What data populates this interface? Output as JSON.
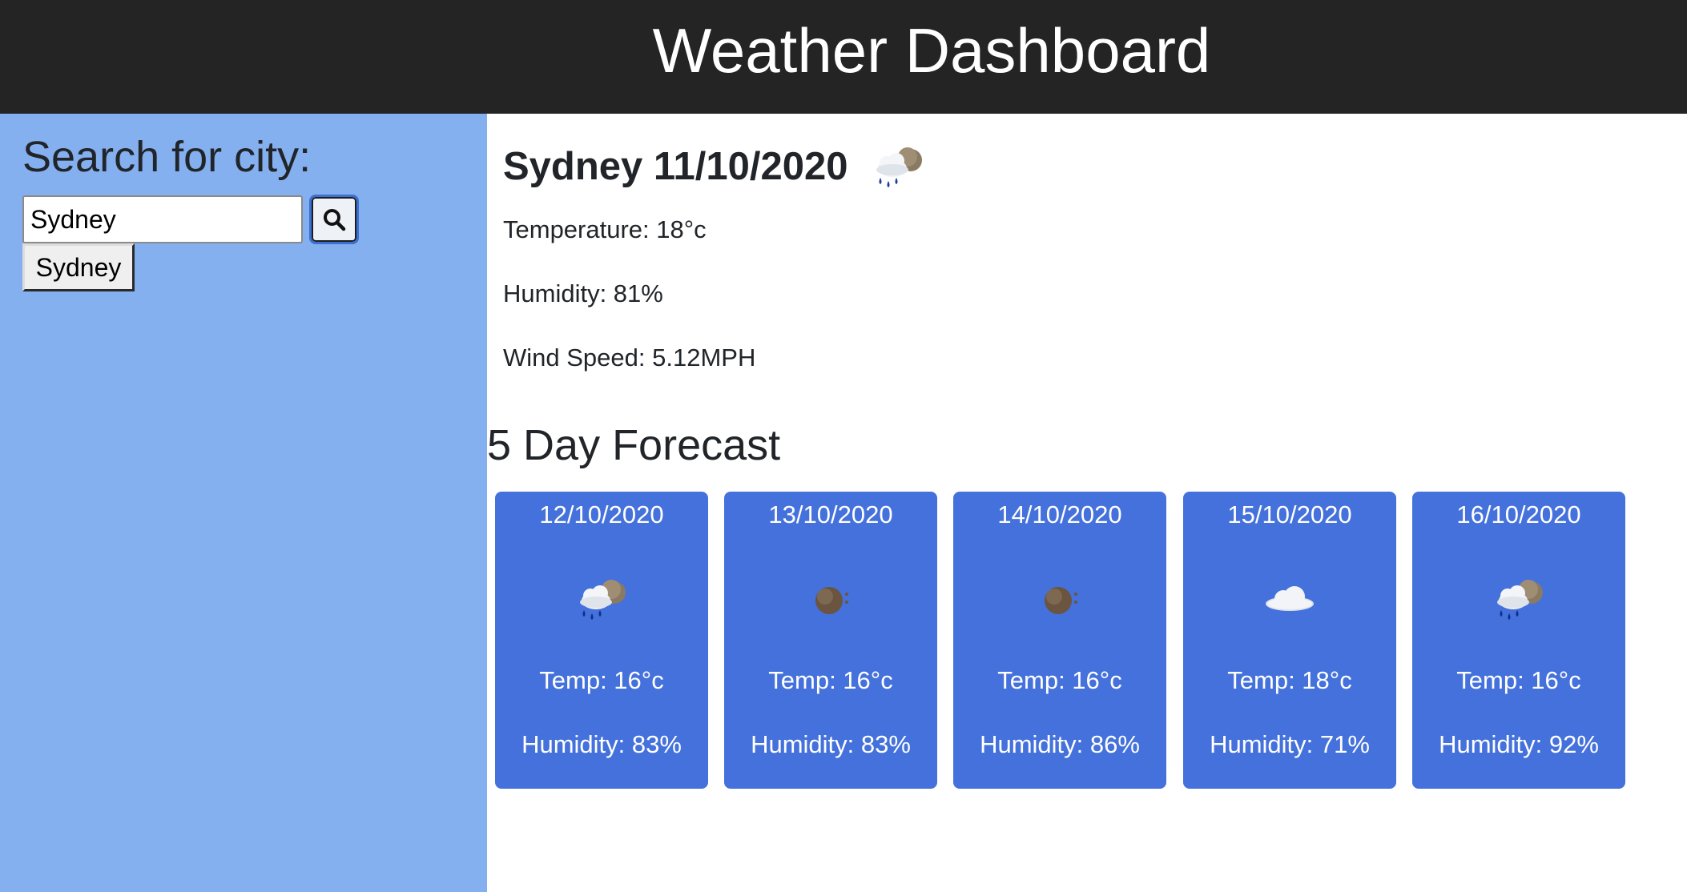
{
  "header": {
    "title": "Weather Dashboard"
  },
  "sidebar": {
    "title": "Search for city:",
    "search": {
      "value": "Sydney",
      "placeholder": ""
    },
    "search_button_icon": "search-icon",
    "history": [
      "Sydney"
    ]
  },
  "current": {
    "city_date": "Sydney 11/10/2020",
    "icon": "rain-cloud-icon",
    "temperature": "Temperature: 18°c",
    "humidity": "Humidity: 81%",
    "wind": "Wind Speed: 5.12MPH"
  },
  "forecast": {
    "title": "5 Day Forecast",
    "days": [
      {
        "date": "12/10/2020",
        "icon": "rain-cloud-icon",
        "temp": "Temp: 16°c",
        "humidity": "Humidity: 83%"
      },
      {
        "date": "13/10/2020",
        "icon": "night-moon-icon",
        "temp": "Temp: 16°c",
        "humidity": "Humidity: 83%"
      },
      {
        "date": "14/10/2020",
        "icon": "night-moon-icon",
        "temp": "Temp: 16°c",
        "humidity": "Humidity: 86%"
      },
      {
        "date": "15/10/2020",
        "icon": "cloud-icon",
        "temp": "Temp: 18°c",
        "humidity": "Humidity: 71%"
      },
      {
        "date": "16/10/2020",
        "icon": "rain-cloud-icon",
        "temp": "Temp: 16°c",
        "humidity": "Humidity: 92%"
      }
    ]
  },
  "colors": {
    "header_bg": "#242424",
    "sidebar_bg": "#84b0f0",
    "card_bg": "#4471db"
  }
}
